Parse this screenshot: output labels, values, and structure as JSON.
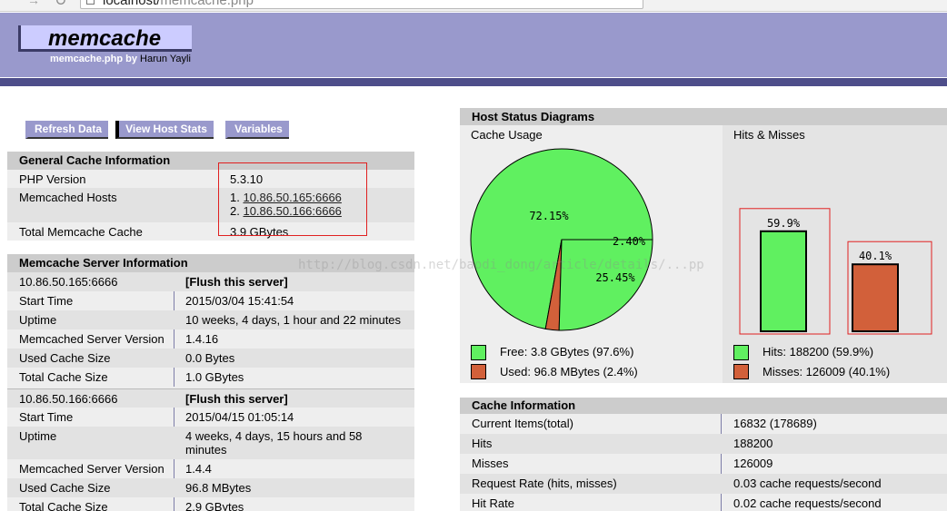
{
  "browser": {
    "url_host": "localhost/",
    "url_path": "memcache.php"
  },
  "header": {
    "logo": "memcache",
    "byline_prefix": "memcache.php by",
    "author": "Harun Yayli"
  },
  "buttons": {
    "refresh": "Refresh Data",
    "host_stats": "View Host Stats",
    "variables": "Variables"
  },
  "general": {
    "title": "General Cache Information",
    "php_version_label": "PHP Version",
    "php_version": "5.3.10",
    "hosts_label": "Memcached Hosts",
    "host1_num": "1.",
    "host1": "10.86.50.165:6666",
    "host2_num": "2.",
    "host2": "10.86.50.166:6666",
    "total_label": "Total Memcache Cache",
    "total": "3.9 GBytes"
  },
  "servers": {
    "title": "Memcache Server Information",
    "flush_label": "[Flush this server]",
    "labels": {
      "start": "Start Time",
      "uptime": "Uptime",
      "version": "Memcached Server Version",
      "used": "Used Cache Size",
      "total": "Total Cache Size"
    },
    "s1": {
      "host": "10.86.50.165:6666",
      "start": "2015/03/04 15:41:54",
      "uptime": "10 weeks, 4 days, 1 hour and 22 minutes",
      "version": "1.4.16",
      "used": "0.0 Bytes",
      "total": "1.0 GBytes"
    },
    "s2": {
      "host": "10.86.50.166:6666",
      "start": "2015/04/15 01:05:14",
      "uptime_line1": "4 weeks, 4 days, 15 hours and 58",
      "uptime_line2": "minutes",
      "version": "1.4.4",
      "used": "96.8 MBytes",
      "total": "2.9 GBytes"
    }
  },
  "diagrams": {
    "title": "Host Status Diagrams",
    "cache_usage_title": "Cache Usage",
    "hits_misses_title": "Hits & Misses",
    "free_legend": "Free: 3.8 GBytes (97.6%)",
    "used_legend": "Used: 96.8 MBytes (2.4%)",
    "hits_legend": "Hits: 188200 (59.9%)",
    "misses_legend": "Misses: 126009 (40.1%)",
    "colors": {
      "green": "#60f060",
      "orange": "#d2603a"
    }
  },
  "chart_data": [
    {
      "type": "pie",
      "title": "Cache Usage",
      "slices": [
        {
          "label": "72.15%",
          "value": 72.15
        },
        {
          "label": "2.40%",
          "value": 2.4
        },
        {
          "label": "25.45%",
          "value": 25.45
        }
      ]
    },
    {
      "type": "bar",
      "title": "Hits & Misses",
      "categories": [
        "Hits",
        "Misses"
      ],
      "values": [
        59.9,
        40.1
      ],
      "labels": [
        "59.9%",
        "40.1%"
      ]
    }
  ],
  "cache_info": {
    "title": "Cache Information",
    "rows": [
      {
        "k": "Current Items(total)",
        "v": "16832 (178689)"
      },
      {
        "k": "Hits",
        "v": "188200"
      },
      {
        "k": "Misses",
        "v": "126009"
      },
      {
        "k": "Request Rate (hits, misses)",
        "v": "0.03 cache requests/second"
      },
      {
        "k": "Hit Rate",
        "v": "0.02 cache requests/second"
      }
    ]
  },
  "watermark": "http://blog.csdn.net/baodi_dong/article/details/...pp"
}
